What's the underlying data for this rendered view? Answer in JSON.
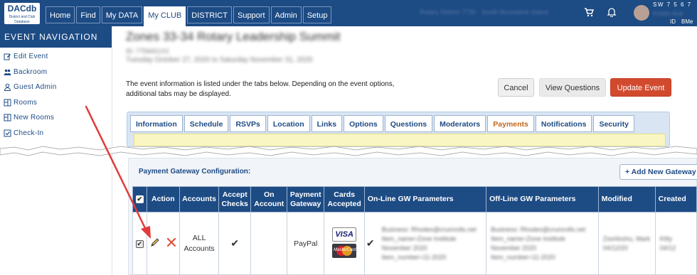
{
  "logo": {
    "line1": "DACdb",
    "line2": "District and Club Database"
  },
  "nav": {
    "tabs": [
      "Home",
      "Find",
      "My DATA",
      "My CLUB",
      "DISTRICT",
      "Support",
      "Admin",
      "Setup"
    ],
    "active": "My CLUB",
    "district_text": "Rotary District 7730 · South Brunswick Island",
    "user_name": "Kristin Ace",
    "sw_text": "SW 7 5 6 7",
    "id_label": "ID",
    "bme_label": "BMe"
  },
  "sidebar": {
    "title": "EVENT NAVIGATION",
    "items": [
      {
        "label": "Edit Event",
        "icon": "edit-icon"
      },
      {
        "label": "Backroom",
        "icon": "users-icon"
      },
      {
        "label": "Guest Admin",
        "icon": "user-icon"
      },
      {
        "label": "Rooms",
        "icon": "rooms-icon"
      },
      {
        "label": "New Rooms",
        "icon": "rooms-icon"
      },
      {
        "label": "Check-In",
        "icon": "checkbox-icon"
      }
    ]
  },
  "event": {
    "title": "Zones 33-34 Rotary Leadership Summit",
    "id_text": "ID: 7756651X3",
    "dates": "Tuesday October 27, 2020 to Saturday November 31, 2020",
    "info": "The event information is listed under the tabs below. Depending on the event options, additional tabs may be displayed."
  },
  "buttons": {
    "cancel": "Cancel",
    "view_questions": "View Questions",
    "update": "Update Event"
  },
  "tabs": {
    "items": [
      "Information",
      "Schedule",
      "RSVPs",
      "Location",
      "Links",
      "Options",
      "Questions",
      "Moderators",
      "Payments",
      "Notifications",
      "Security"
    ],
    "active": "Payments"
  },
  "payment_gateway": {
    "title": "Payment Gateway Configuration:",
    "add_button": "+ Add New Gateway",
    "columns": [
      "Action",
      "Accounts",
      "Accept Checks",
      "On Account",
      "Payment Gateway",
      "Cards Accepted",
      "On-Line GW Parameters",
      "Off-Line GW Parameters",
      "Modified",
      "Created"
    ],
    "rows": [
      {
        "accounts": "ALL Accounts",
        "accept_checks": "✔",
        "on_account": "",
        "gateway": "PayPal",
        "cards": [
          "VISA",
          "MasterCard"
        ],
        "online_params": [
          "Business: Rhodes@crumrolls.net",
          "Item_name=Zone Institute",
          "November 2020",
          "Item_number=11-2020"
        ],
        "offline_params": [
          "Business: Rhodes@crumrolls.net",
          "Item_name=Zone Institute",
          "November 2020",
          "Item_number=11-2020"
        ],
        "modified": [
          "Zsorlioshu, Mark",
          "04/12/20"
        ],
        "created": [
          "Kitty",
          "04/12"
        ]
      }
    ]
  },
  "colors": {
    "brand_blue": "#1d4b84",
    "update_red": "#d24a2e",
    "active_tab_orange": "#c4671a",
    "arrow_red": "#e23a3a"
  }
}
